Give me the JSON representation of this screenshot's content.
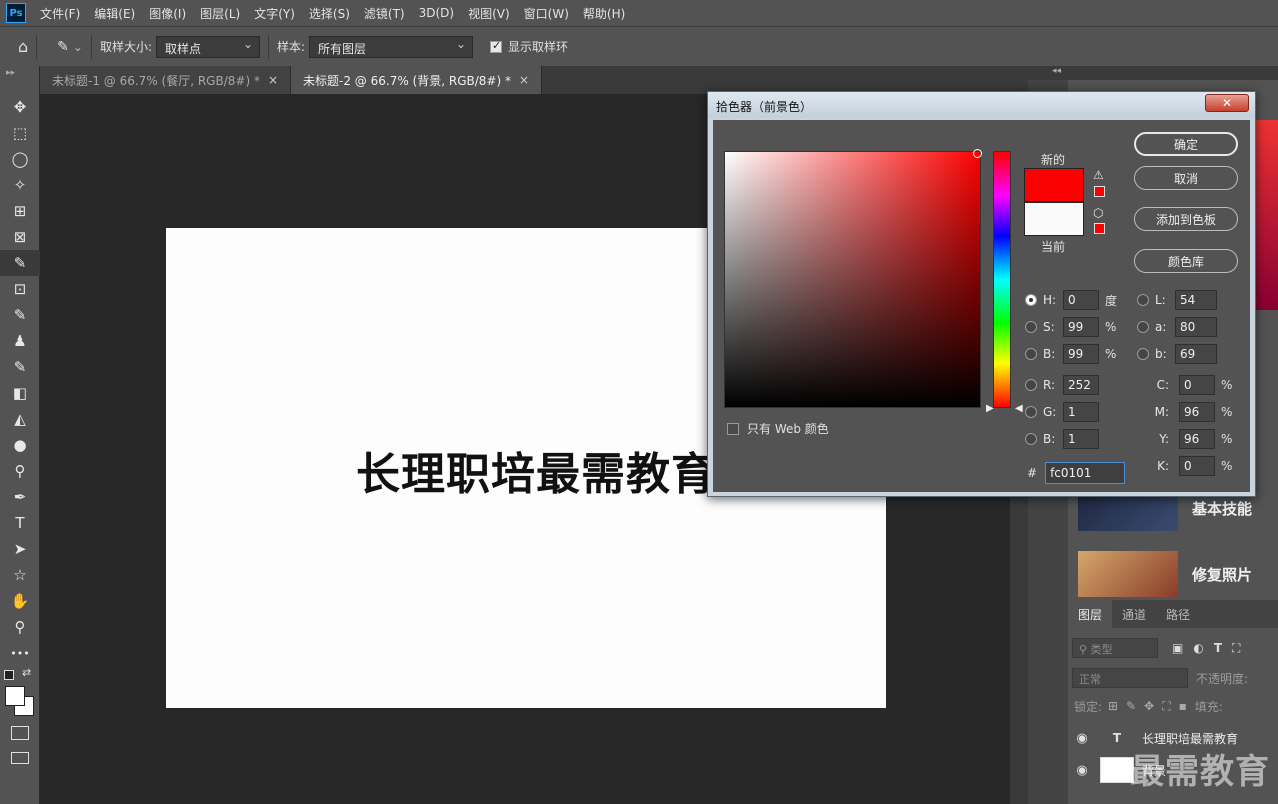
{
  "app": {
    "logo": "Ps"
  },
  "menu": [
    "文件(F)",
    "编辑(E)",
    "图像(I)",
    "图层(L)",
    "文字(Y)",
    "选择(S)",
    "滤镜(T)",
    "3D(D)",
    "视图(V)",
    "窗口(W)",
    "帮助(H)"
  ],
  "options": {
    "home_icon": "⌂",
    "eyedropper_icon": "✎",
    "sample_size_label": "取样大小:",
    "sample_size_value": "取样点",
    "sample_label": "样本:",
    "sample_value": "所有图层",
    "show_ring_label": "显示取样环"
  },
  "tabs": [
    {
      "label": "未标题-1 @ 66.7% (餐厅, RGB/8#) *",
      "close": "×"
    },
    {
      "label": "未标题-2 @ 66.7% (背景, RGB/8#) *",
      "close": "×"
    }
  ],
  "tools": [
    "✥",
    "⬚",
    "◯",
    "✧",
    "⊞",
    "⊠",
    "✎",
    "⊡",
    "✎",
    "♟",
    "✎",
    "◧",
    "◭",
    "●",
    "⚲",
    "✒",
    "T",
    "➤",
    "☆",
    "✋",
    "⚲",
    "•••"
  ],
  "document": {
    "text": "长理职培最需教育"
  },
  "learn": [
    {
      "label": "基本技能"
    },
    {
      "label": "修复照片"
    }
  ],
  "layers": {
    "tabs": [
      "图层",
      "通道",
      "路径"
    ],
    "filter_placeholder": "⚲ 类型",
    "blend_mode": "正常",
    "opacity_label": "不透明度:",
    "lock_label": "锁定:",
    "fill_label": "填充:",
    "items": [
      {
        "name": "长理职培最需教育",
        "kind_icon": "T",
        "eye": "◉"
      },
      {
        "name": "背景",
        "eye": "◉"
      }
    ]
  },
  "watermark": "最需教育",
  "picker": {
    "title": "拾色器（前景色）",
    "close_icon": "✕",
    "new_label": "新的",
    "current_label": "当前",
    "new_color": "#fc0101",
    "current_color": "#fafafa",
    "gamut_warning_icon": "⚠",
    "websafe_icon": "⬡",
    "web_only_label": "只有 Web 颜色",
    "buttons": [
      "确定",
      "取消",
      "添加到色板",
      "颜色库"
    ],
    "hsb": [
      {
        "label": "H:",
        "value": "0",
        "unit": "度",
        "selected": true
      },
      {
        "label": "S:",
        "value": "99",
        "unit": "%"
      },
      {
        "label": "B:",
        "value": "99",
        "unit": "%"
      }
    ],
    "rgb": [
      {
        "label": "R:",
        "value": "252"
      },
      {
        "label": "G:",
        "value": "1"
      },
      {
        "label": "B:",
        "value": "1"
      }
    ],
    "lab": [
      {
        "label": "L:",
        "value": "54"
      },
      {
        "label": "a:",
        "value": "80"
      },
      {
        "label": "b:",
        "value": "69"
      }
    ],
    "cmyk": [
      {
        "label": "C:",
        "value": "0",
        "unit": "%"
      },
      {
        "label": "M:",
        "value": "96",
        "unit": "%"
      },
      {
        "label": "Y:",
        "value": "96",
        "unit": "%"
      },
      {
        "label": "K:",
        "value": "0",
        "unit": "%"
      }
    ],
    "hex_label": "#",
    "hex_value": "fc0101"
  }
}
